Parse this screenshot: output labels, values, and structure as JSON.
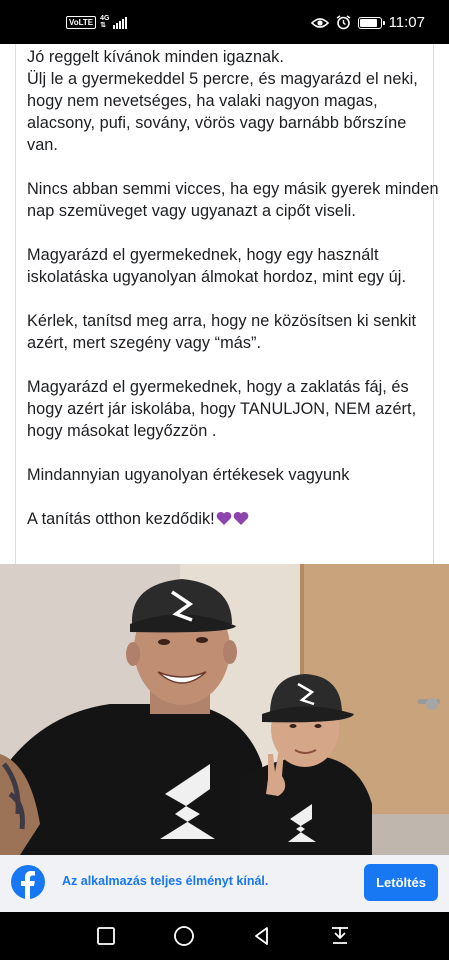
{
  "status_bar": {
    "volte": "VoLTE",
    "network": "4G",
    "time": "11:07",
    "battery_level": 0.85,
    "icons": [
      "eye-icon",
      "alarm-icon",
      "battery-icon",
      "signal-icon"
    ]
  },
  "post": {
    "paragraphs": [
      "Jó reggelt kívánok minden igaznak.\nÜlj le a gyermekeddel  5 percre, és magyarázd el neki, hogy nem nevetséges, ha valaki nagyon magas, alacsony, pufi, sovány, vörös vagy barnább  bőrszíne van.",
      "Nincs abban semmi vicces, ha egy másik gyerek minden nap szemüveget  vagy ugyanazt a cipőt viseli.",
      "Magyarázd el gyermekednek, hogy egy használt iskolatáska ugyanolyan álmokat hordoz, mint egy új.",
      "Kérlek, tanítsd meg  arra, hogy ne közösítsen ki senkit azért, mert szegény vagy “más”.",
      "Magyarázd el gyermekednek, hogy a zaklatás fáj, és hogy azért jár iskolába, hogy TANULJON, NEM azért, hogy másokat legyőzzön .",
      "Mindannyian ugyanolyan értékesek vagyunk"
    ],
    "closing": "A tanítás otthon kezdődik!",
    "emoji": [
      "purple-heart",
      "purple-heart"
    ]
  },
  "banner": {
    "text": "Az alkalmazás teljes élményt kínál.",
    "button_label": "Letöltés"
  },
  "colors": {
    "facebook_blue": "#1877f2",
    "heart_purple": "#8e44ad"
  },
  "navbar": {
    "icons": [
      "recent-apps-icon",
      "home-icon",
      "back-icon",
      "notification-pull-icon"
    ]
  }
}
